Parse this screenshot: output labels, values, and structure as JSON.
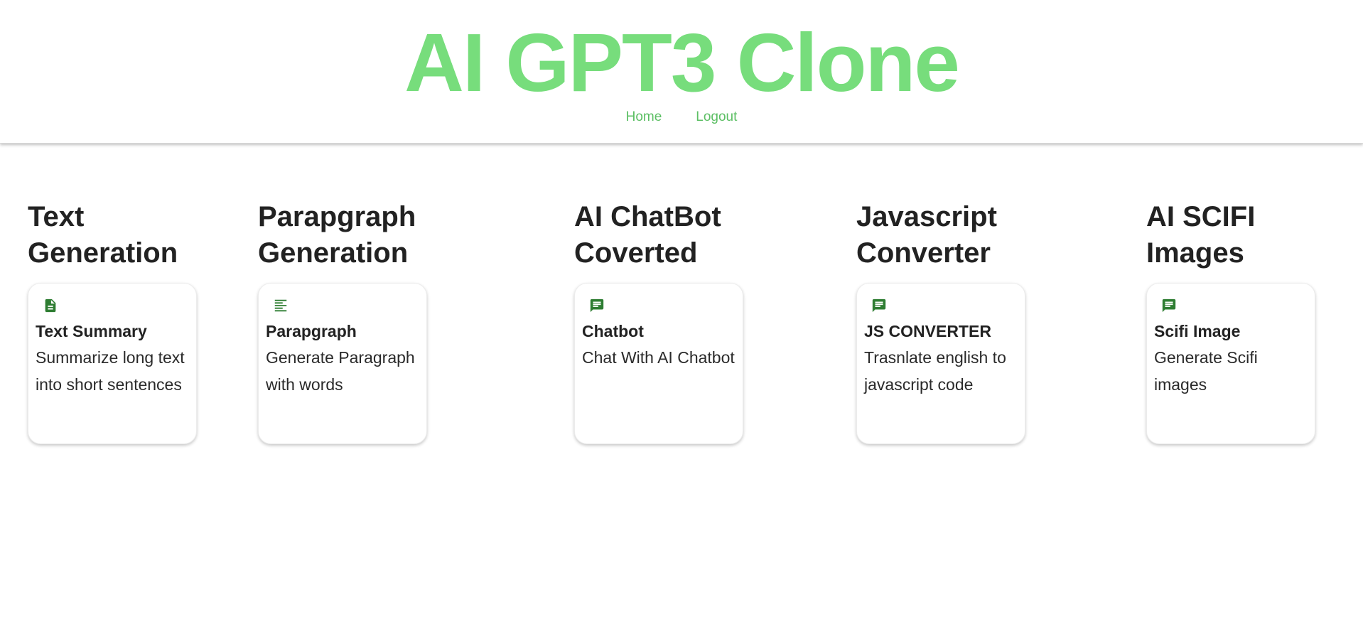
{
  "header": {
    "title": "AI GPT3 Clone",
    "nav": [
      {
        "label": "Home"
      },
      {
        "label": "Logout"
      }
    ]
  },
  "colors": {
    "title": "#77dd7c",
    "nav_link": "#5cbf64",
    "icon": "#2e7d32"
  },
  "sections": [
    {
      "heading": "Text Generation",
      "card": {
        "icon": "description-icon",
        "title": "Text Summary",
        "description": "Summarize long text into short sentences"
      }
    },
    {
      "heading": "Parapgraph Generation",
      "card": {
        "icon": "notes-icon",
        "title": "Parapgraph",
        "description": "Generate Paragraph with words"
      }
    },
    {
      "heading": "AI ChatBot Coverted",
      "card": {
        "icon": "chat-icon",
        "title": "Chatbot",
        "description": "Chat With AI Chatbot"
      }
    },
    {
      "heading": "Javascript Converter",
      "card": {
        "icon": "chat-icon",
        "title": "JS CONVERTER",
        "description": "Trasnlate english to javascript code"
      }
    },
    {
      "heading": "AI SCIFI Images",
      "card": {
        "icon": "chat-icon",
        "title": "Scifi Image",
        "description": "Generate Scifi images"
      }
    }
  ]
}
